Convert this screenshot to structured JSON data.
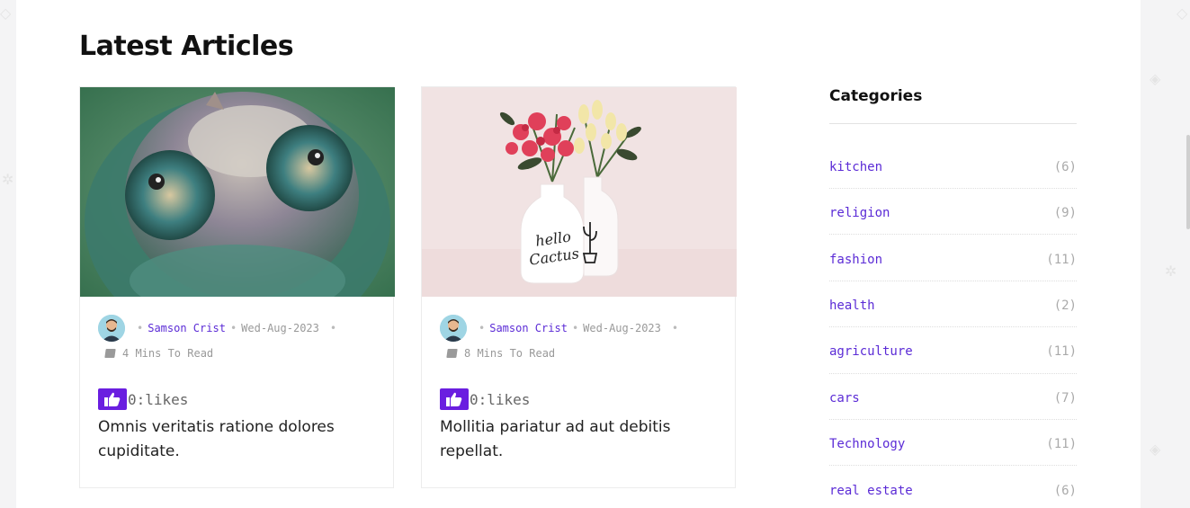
{
  "section": {
    "title": "Latest Articles"
  },
  "articles": [
    {
      "author": "Samson Crist",
      "date": "Wed-Aug-2023",
      "read_time": "4 Mins To Read",
      "likes": "0:likes",
      "title": "Omnis veritatis ratione dolores cupiditate.",
      "image": "chameleon-photo"
    },
    {
      "author": "Samson Crist",
      "date": "Wed-Aug-2023",
      "read_time": "8 Mins To Read",
      "likes": "0:likes",
      "title": "Mollitia pariatur ad aut debitis repellat.",
      "image": "flower-vases-photo",
      "vase_text": "hello Cactus"
    }
  ],
  "sidebar": {
    "title": "Categories",
    "categories": [
      {
        "name": "kitchen",
        "count": "(6)"
      },
      {
        "name": "religion",
        "count": "(9)"
      },
      {
        "name": "fashion",
        "count": "(11)"
      },
      {
        "name": "health",
        "count": "(2)"
      },
      {
        "name": "agriculture",
        "count": "(11)"
      },
      {
        "name": "cars",
        "count": "(7)"
      },
      {
        "name": "Technology",
        "count": "(11)"
      },
      {
        "name": "real estate",
        "count": "(6)"
      }
    ]
  },
  "colors": {
    "accent": "#5b2bd6",
    "like_button": "#6a1ee0"
  },
  "icons": {
    "like": "thumbs-up-icon",
    "read_time": "book-icon",
    "avatar": "user-avatar-icon"
  }
}
